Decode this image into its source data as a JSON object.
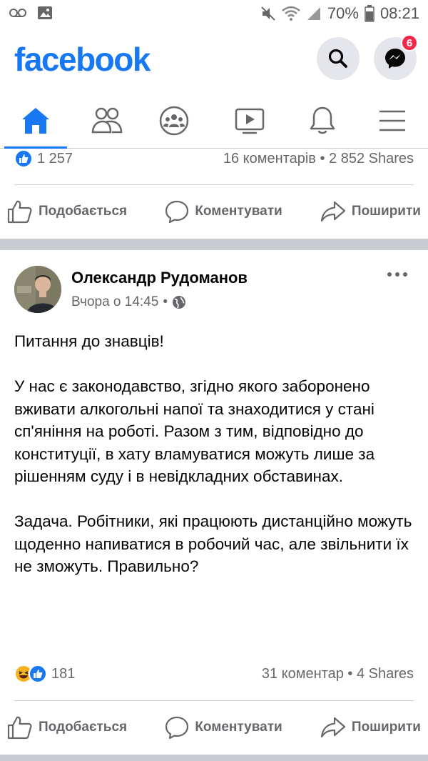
{
  "status_bar": {
    "battery": "70%",
    "time": "08:21"
  },
  "header": {
    "logo": "facebook",
    "messenger_badge": "6"
  },
  "nav": {
    "items": [
      "home-icon",
      "friends-icon",
      "groups-icon",
      "watch-icon",
      "notifications-icon",
      "menu-icon"
    ],
    "active": "home"
  },
  "prev_post": {
    "likes": "1 257",
    "comments_shares": "16 коментарів • 2 852 Shares"
  },
  "actions": {
    "like": "Подобається",
    "comment": "Коментувати",
    "share": "Поширити"
  },
  "post": {
    "author": "Олександр Рудоманов",
    "time": "Вчора о 14:45",
    "dot": "•",
    "paragraphs": [
      "Питання до знавців!",
      "У нас є законодавство, згідно якого заборонено вживати алкогольні напої та знаходитися у стані сп'яніння на роботі. Разом з тим, відповідно до конституції, в хату вламуватися можуть лише за рішенням суду і в невідкладних обставинах.",
      "Задача. Робітники, які працюють дистанційно можуть щоденно напиватися в робочий час, але звільнити їх не зможуть. Правильно?"
    ],
    "reactions_count": "181",
    "comments_shares": "31 коментар • 4 Shares"
  },
  "colors": {
    "brand": "#1877f2",
    "secondary_text": "#65676b",
    "badge": "#f02849",
    "separator": "#c9ccd1"
  }
}
